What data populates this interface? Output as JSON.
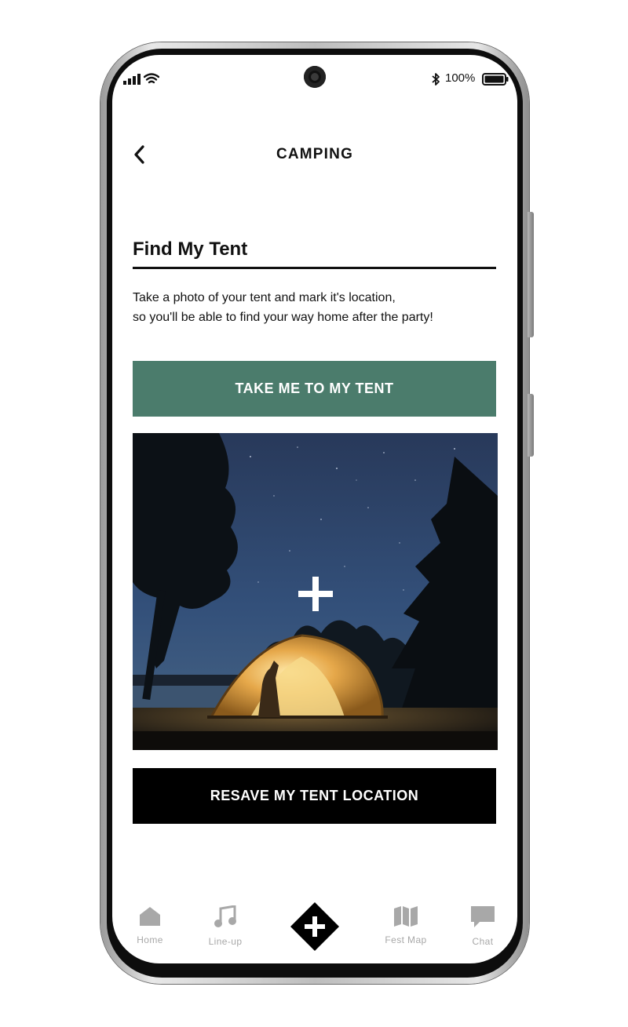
{
  "status_bar": {
    "battery_text": "100%",
    "icons": [
      "signal-icon",
      "wifi-icon",
      "bluetooth-icon",
      "battery-icon"
    ]
  },
  "header": {
    "title": "CAMPING",
    "back_icon": "chevron-left-icon"
  },
  "section": {
    "title": "Find My Tent",
    "description_lines": [
      "Take a photo of your tent and mark it's location,",
      "so you'll be able to find your way home after the party!"
    ]
  },
  "buttons": {
    "take_me_label": "TAKE ME TO MY TENT",
    "resave_label": "RESAVE MY TENT LOCATION"
  },
  "photo": {
    "overlay_icon": "plus-icon"
  },
  "bottom_nav": {
    "items": [
      {
        "label": "Home",
        "icon": "home-icon"
      },
      {
        "label": "Line-up",
        "icon": "music-note-icon"
      },
      {
        "label": "",
        "icon": "add-plus-diamond-icon"
      },
      {
        "label": "Fest Map",
        "icon": "map-icon"
      },
      {
        "label": "Chat",
        "icon": "chat-bubble-icon"
      }
    ]
  },
  "colors": {
    "primary_button": "#4b7c6c",
    "secondary_button": "#000000",
    "nav_inactive": "#a8a8a8"
  }
}
